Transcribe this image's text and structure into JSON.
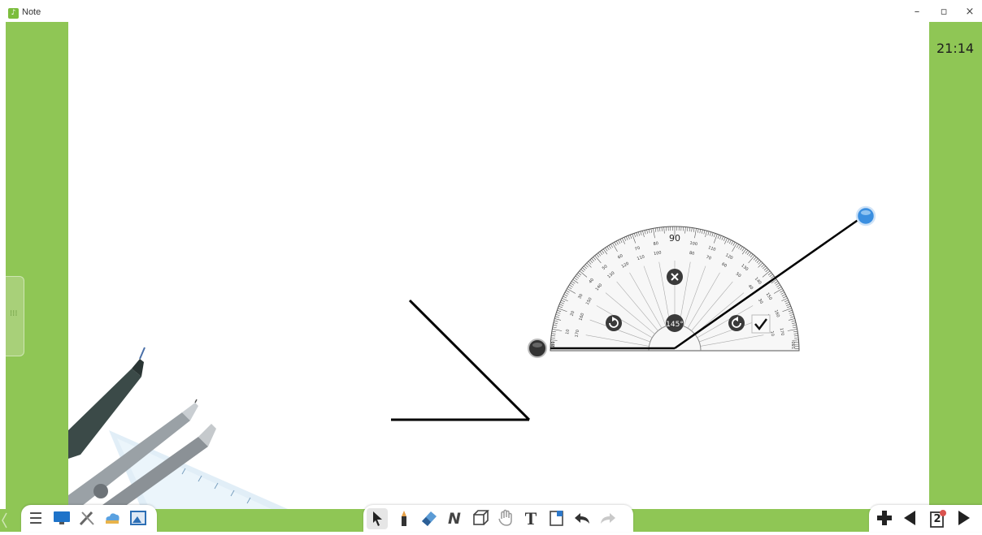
{
  "window": {
    "title": "Note",
    "controls": {
      "minimize": "–",
      "maximize": "▫",
      "close": "×"
    }
  },
  "clock": "21:14",
  "side_handle_glyph": "⁝⁝⁝",
  "protractor": {
    "top_label": "90",
    "outer_scale": [
      "10",
      "20",
      "30",
      "40",
      "50",
      "60",
      "70",
      "80",
      "100",
      "110",
      "120",
      "130",
      "140",
      "150",
      "160",
      "170"
    ],
    "inner_scale": [
      "170",
      "160",
      "150",
      "140",
      "130",
      "120",
      "110",
      "100",
      "80",
      "70",
      "60",
      "50",
      "40",
      "30",
      "20",
      "10"
    ],
    "angle_readout": "145°",
    "edge_labels": {
      "left": "180",
      "right": "180"
    }
  },
  "toolbars": {
    "left": [
      "menu-icon",
      "display-icon",
      "tools-icon",
      "cloud-upload-icon",
      "image-icon"
    ],
    "center": [
      "select-icon",
      "pen-icon",
      "eraser-icon",
      "shape-icon",
      "cube-icon",
      "hand-icon",
      "text-icon",
      "background-icon",
      "undo-icon",
      "redo-icon"
    ],
    "right": [
      "add-page-icon",
      "previous-page-icon",
      "page-indicator",
      "next-page-icon"
    ],
    "page_number": "2"
  },
  "colors": {
    "frame_green": "#8fc655",
    "protractor_handle_blue": "#3b8fe0",
    "accent_red": "#d9534f"
  }
}
